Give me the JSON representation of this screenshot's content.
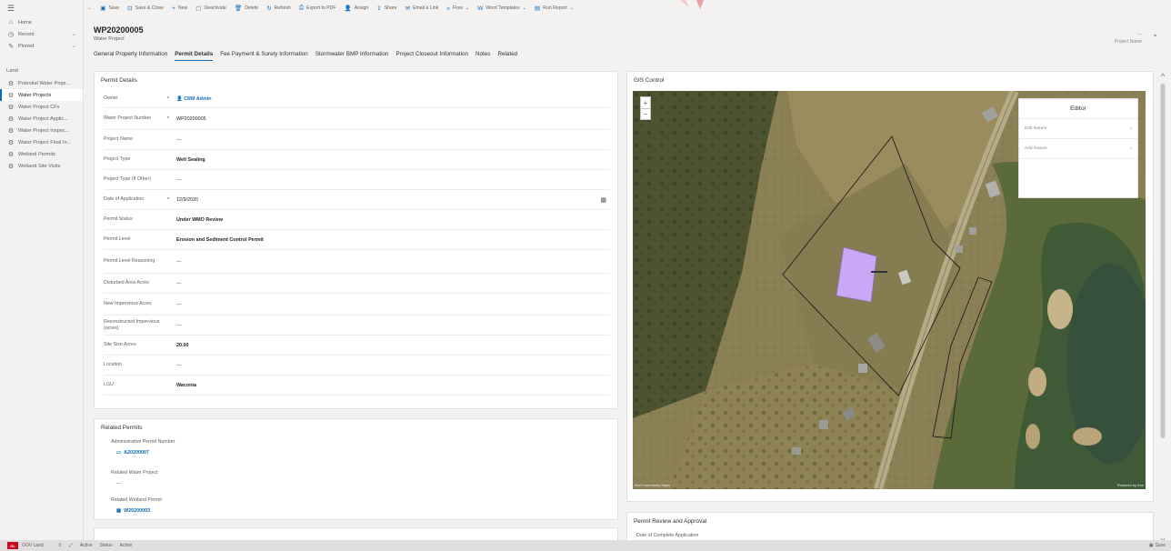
{
  "sidebar": {
    "nav": [
      {
        "icon": "home-icon",
        "label": "Home"
      },
      {
        "icon": "recent-icon",
        "label": "Recent"
      },
      {
        "icon": "pin-icon",
        "label": "Pinned"
      }
    ],
    "group_label": "Land",
    "items": [
      {
        "label": "Potential Water Proje...",
        "active": false
      },
      {
        "label": "Water Projects",
        "active": true
      },
      {
        "label": "Water Project CFs",
        "active": false
      },
      {
        "label": "Water Project Applic...",
        "active": false
      },
      {
        "label": "Water Project Inspec...",
        "active": false
      },
      {
        "label": "Water Project Final In...",
        "active": false
      },
      {
        "label": "Wetland Permits",
        "active": false
      },
      {
        "label": "Wetland Site Visits",
        "active": false
      }
    ],
    "area": {
      "badge": "GL",
      "label": "GOV Land"
    }
  },
  "commandbar": [
    {
      "icon": "save-icon",
      "label": "Save"
    },
    {
      "icon": "save-close-icon",
      "label": "Save & Close"
    },
    {
      "icon": "plus-icon",
      "label": "New"
    },
    {
      "icon": "deactivate-icon",
      "label": "Deactivate"
    },
    {
      "icon": "delete-icon",
      "label": "Delete"
    },
    {
      "icon": "refresh-icon",
      "label": "Refresh"
    },
    {
      "icon": "pdf-icon",
      "label": "Export to PDF"
    },
    {
      "icon": "assign-icon",
      "label": "Assign"
    },
    {
      "icon": "share-icon",
      "label": "Share"
    },
    {
      "icon": "email-link-icon",
      "label": "Email a Link"
    },
    {
      "icon": "flow-icon",
      "label": "Flow"
    },
    {
      "icon": "word-icon",
      "label": "Word Templates"
    },
    {
      "icon": "report-icon",
      "label": "Run Report"
    }
  ],
  "record": {
    "title": "WP20200005",
    "subtitle": "Water Project",
    "owner_caption": "Project Name",
    "owner_dash": "---"
  },
  "tabs": [
    "General Property Information",
    "Permit Details",
    "Fee Payment & Surety Information",
    "Stormwater BMP Information",
    "Project Closeout Information",
    "Notes",
    "Related"
  ],
  "permit_details": {
    "title": "Permit Details",
    "fields": [
      {
        "label": "Owner",
        "req": "*",
        "value": "CRM Admin",
        "style": "link"
      },
      {
        "label": "Water Project Number",
        "req": "*",
        "value": "WP20200005",
        "style": "plain"
      },
      {
        "label": "Project Name",
        "req": "",
        "value": "---",
        "style": "plain"
      },
      {
        "label": "Project Type",
        "req": "",
        "value": "Well Sealing",
        "style": "bold"
      },
      {
        "label": "Project Type (If Other)",
        "req": "",
        "value": "---",
        "style": "plain"
      },
      {
        "label": "Date of Application",
        "req": "*",
        "value": "12/9/2020",
        "style": "plain"
      },
      {
        "label": "Permit Status",
        "req": "",
        "value": "Under WMO Review",
        "style": "bold"
      },
      {
        "label": "Permit Level",
        "req": "",
        "value": "Erosion and Sediment Control Permit",
        "style": "bold"
      },
      {
        "label": "Permit Level Reasoning",
        "req": "",
        "value": "---",
        "style": "plain"
      },
      {
        "label": "Disturbed Area Acres",
        "req": "",
        "value": "---",
        "style": "plain"
      },
      {
        "label": "New Impervious Acres",
        "req": "",
        "value": "---",
        "style": "plain"
      },
      {
        "label": "Reconstructed Impervious (acres)",
        "req": "",
        "value": "---",
        "style": "plain"
      },
      {
        "label": "Site Size Acres",
        "req": "",
        "value": "20.00",
        "style": "bold"
      },
      {
        "label": "Location",
        "req": "",
        "value": "---",
        "style": "plain"
      },
      {
        "label": "LGU",
        "req": "",
        "value": "Waconia",
        "style": "bold"
      }
    ]
  },
  "related_permits": {
    "title": "Related Permits",
    "admin_label": "Administrative Permit Number",
    "admin_value": "A20200007",
    "water_label": "Related Water Project",
    "water_value": "---",
    "wetland_label": "Related Wetland Permit",
    "wetland_value": "W20200003"
  },
  "gis": {
    "title": "GIS Control",
    "editor_title": "Editor",
    "editor_rows": [
      "Edit feature",
      "Add feature"
    ],
    "attribution_left": "Esri Community Maps",
    "attribution_right": "Powered by Esri"
  },
  "review": {
    "title": "Permit Review and Approval",
    "first_field": "Date of Complete Application"
  },
  "statusbar": {
    "items": [
      "Active",
      "Status",
      "Active"
    ],
    "save": "Save"
  },
  "colors": {
    "accent": "#0f6cbd",
    "polygon": "#c9a9f5",
    "area_badge": "#c50f1f"
  }
}
